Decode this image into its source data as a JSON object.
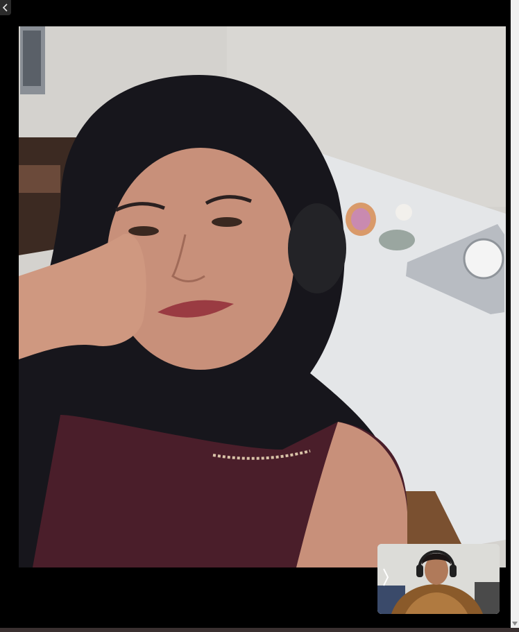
{
  "window": {
    "back_icon": "chevron-left-icon"
  },
  "call": {
    "remote_video": {
      "icon": "video-feed"
    },
    "self_view": {
      "toggle_icon": "chevron-right-icon"
    }
  },
  "scrollbar": {
    "down_icon": "scroll-down-arrow-icon"
  },
  "colors": {
    "background": "#000000",
    "scrollbar": "#f0f0f0"
  }
}
